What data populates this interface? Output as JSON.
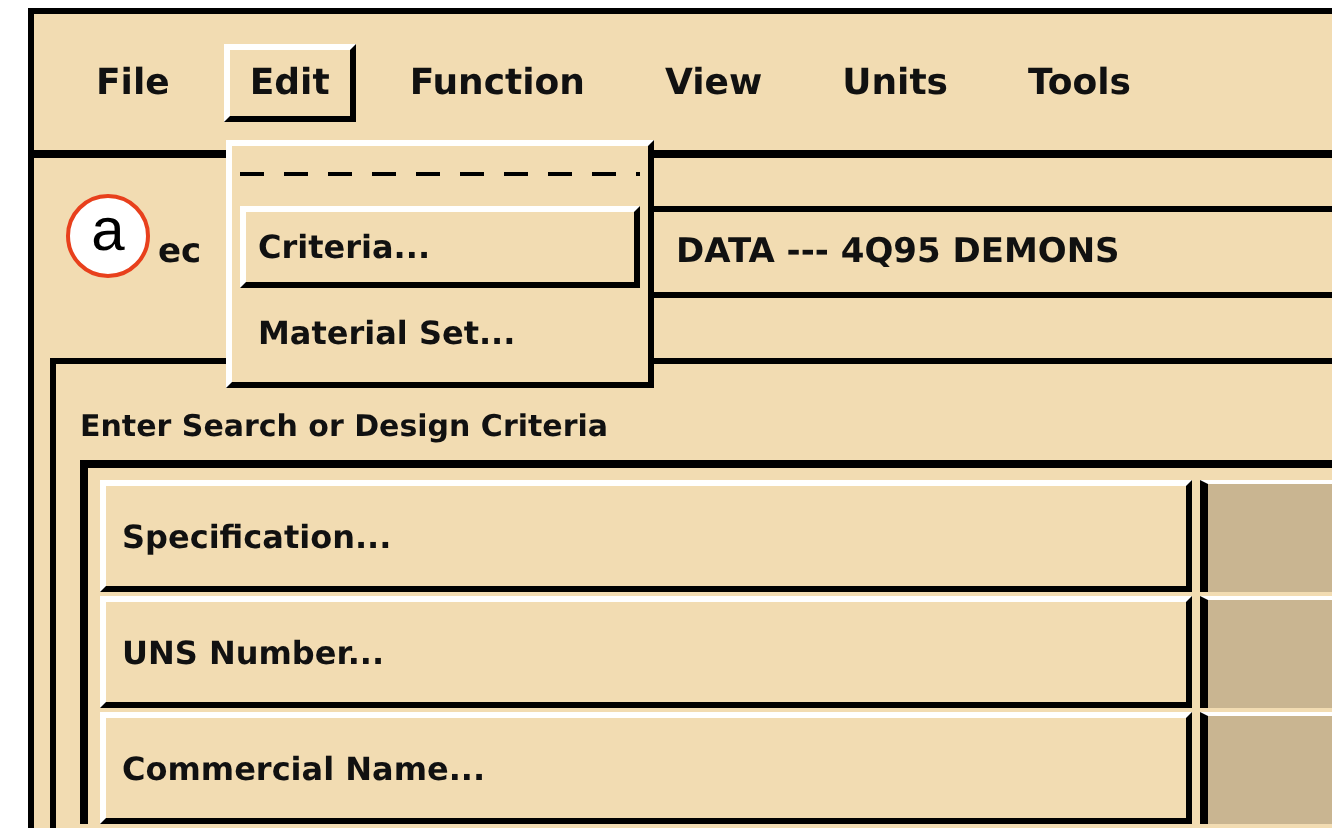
{
  "menu_bar": [
    {
      "label": "File",
      "selected": false
    },
    {
      "label": "Edit",
      "selected": true
    },
    {
      "label": "Function",
      "selected": false
    },
    {
      "label": "View",
      "selected": false
    },
    {
      "label": "Units",
      "selected": false
    },
    {
      "label": "Tools",
      "selected": false
    }
  ],
  "edit_menu": {
    "items": [
      {
        "label": "Criteria...",
        "selected": true
      },
      {
        "label": "Material Set...",
        "selected": false
      }
    ]
  },
  "selection_row": {
    "label": "ec",
    "value": "DATA --- 4Q95 DEMONS"
  },
  "annotation": {
    "label": "a"
  },
  "criteria_panel": {
    "title": "Enter Search or Design Criteria",
    "rows": [
      {
        "label": "Specification..."
      },
      {
        "label": "UNS Number..."
      },
      {
        "label": "Commercial Name..."
      }
    ]
  }
}
